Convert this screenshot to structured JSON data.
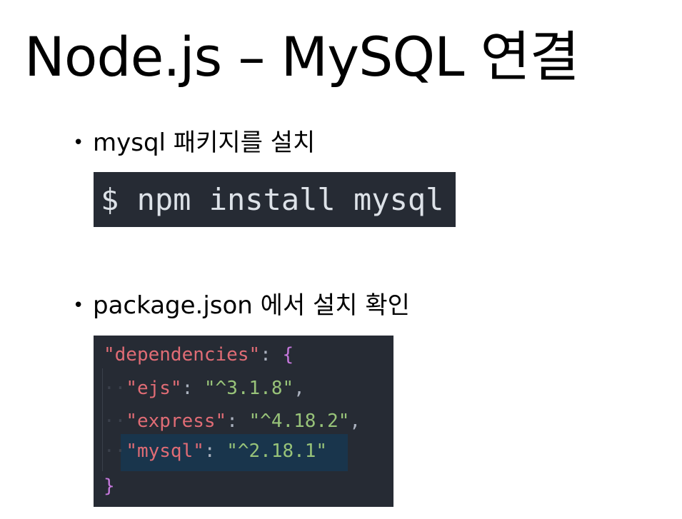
{
  "title": "Node.js – MySQL 연결",
  "bullets": [
    {
      "marker": "•",
      "text": "mysql 패키지를 설치"
    },
    {
      "marker": "•",
      "text": "package.json 에서 설치 확인"
    }
  ],
  "terminal": {
    "command": "$ npm install mysql"
  },
  "package_json": {
    "open": {
      "key": "\"dependencies\"",
      "colon": ": ",
      "brace": "{"
    },
    "entries": [
      {
        "indent": "··",
        "key": "\"ejs\"",
        "sep": ": ",
        "value": "\"^3.1.8\"",
        "trail": ","
      },
      {
        "indent": "··",
        "key": "\"express\"",
        "sep": ": ",
        "value": "\"^4.18.2\"",
        "trail": ","
      },
      {
        "indent": "··",
        "key": "\"mysql\"",
        "sep": ": ",
        "value": "\"^2.18.1\"",
        "trail": ""
      }
    ],
    "close": "}"
  },
  "colors": {
    "code_background": "#262b34",
    "highlight_line": "#19354c",
    "json_key": "#e06c75",
    "json_string": "#98c379",
    "punctuation": "#abb2bf",
    "brace": "#c678dd"
  }
}
